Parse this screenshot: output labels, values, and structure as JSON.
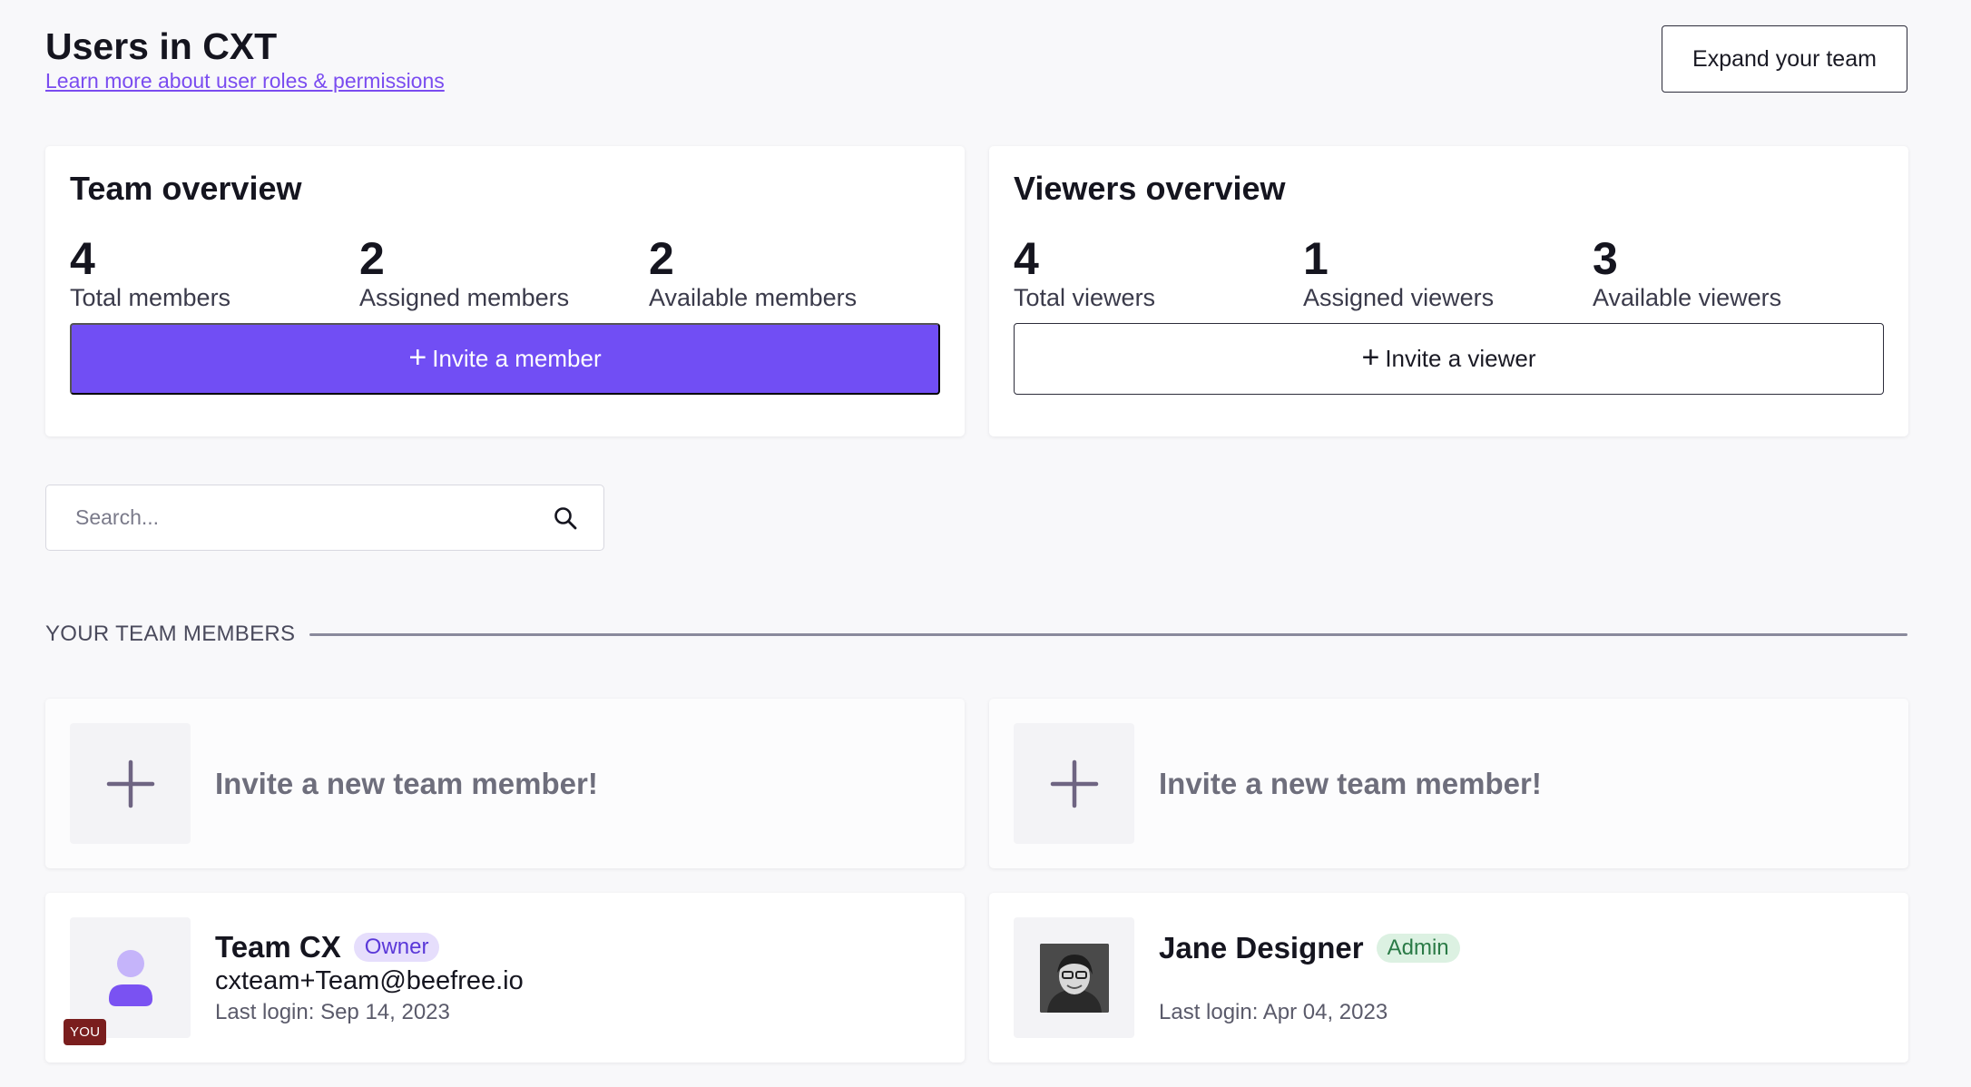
{
  "header": {
    "title": "Users in CXT",
    "roles_link": "Learn more about user roles & permissions",
    "expand_button": "Expand your team"
  },
  "team_overview": {
    "title": "Team overview",
    "stats": [
      {
        "value": "4",
        "label": "Total members"
      },
      {
        "value": "2",
        "label": "Assigned members"
      },
      {
        "value": "2",
        "label": "Available members"
      }
    ],
    "invite_button": "Invite a member"
  },
  "viewers_overview": {
    "title": "Viewers overview",
    "stats": [
      {
        "value": "4",
        "label": "Total viewers"
      },
      {
        "value": "1",
        "label": "Assigned viewers"
      },
      {
        "value": "3",
        "label": "Available viewers"
      }
    ],
    "invite_button": "Invite a viewer"
  },
  "search": {
    "placeholder": "Search...",
    "value": ""
  },
  "members_section": {
    "title": "YOUR TEAM MEMBERS",
    "invite_cards": [
      {
        "label": "Invite a new team member!"
      },
      {
        "label": "Invite a new team member!"
      }
    ],
    "members": [
      {
        "name": "Team CX",
        "role": "Owner",
        "email": "cxteam+Team@beefree.io",
        "last_login": "Last login: Sep 14, 2023",
        "you_badge": "YOU",
        "avatar": "default-avatar-icon"
      },
      {
        "name": "Jane Designer",
        "role": "Admin",
        "email": "",
        "last_login": "Last login: Apr 04, 2023",
        "avatar": "photo"
      }
    ]
  },
  "colors": {
    "accent": "#714ef4",
    "link": "#7a4cf0",
    "owner_badge_bg": "#e6defc",
    "admin_badge_bg": "#dcf1e2",
    "you_badge_bg": "#7a1e1e"
  }
}
